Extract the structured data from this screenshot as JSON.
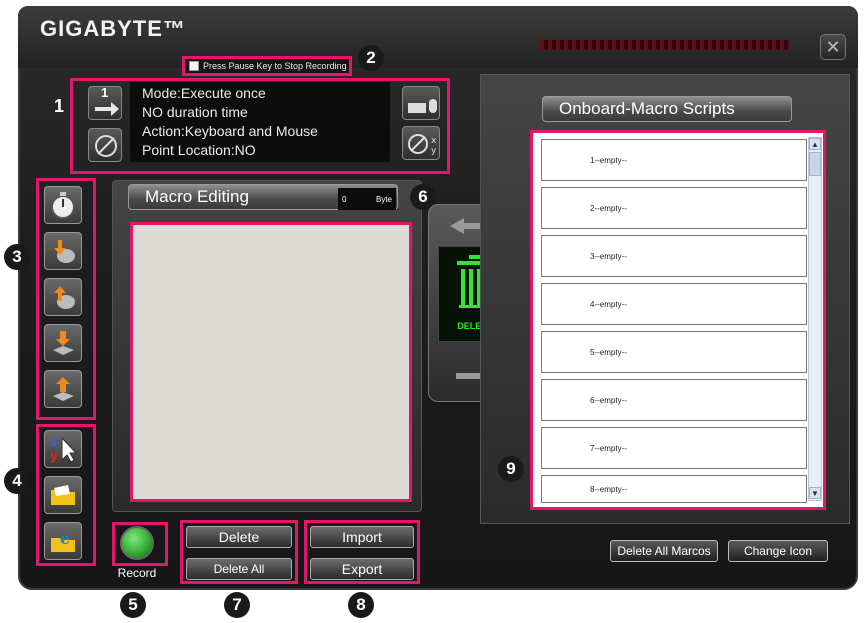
{
  "app": {
    "logo": "GIGABYTE™"
  },
  "recording": {
    "checkbox_label": "Press Pause Key to Stop Recording"
  },
  "mode_info": {
    "lines": [
      "Mode:Execute once",
      "NO duration time",
      "Action:Keyboard and Mouse",
      "Point Location:NO"
    ],
    "left_indicator": "1"
  },
  "macro_editing": {
    "title": "Macro Editing",
    "byte_count": "0",
    "byte_unit": "Byte"
  },
  "buttons": {
    "delete": "Delete",
    "delete_all": "Delete All",
    "import": "Import",
    "export": "Export",
    "record": "Record"
  },
  "trash": {
    "label": "DELETE"
  },
  "onboard": {
    "title": "Onboard-Macro Scripts",
    "slots": [
      "1--empty--",
      "2--empty--",
      "3--empty--",
      "4--empty--",
      "5--empty--",
      "6--empty--",
      "7--empty--",
      "8--empty--"
    ],
    "delete_all": "Delete All Marcos",
    "change_icon": "Change Icon"
  },
  "callouts": [
    "1",
    "2",
    "3",
    "4",
    "5",
    "6",
    "7",
    "8",
    "9"
  ],
  "colors": {
    "highlight": "#e0176a",
    "accent_red": "#6a0a12",
    "record_green": "#2fa52f",
    "trash_green": "#2ee82e"
  }
}
